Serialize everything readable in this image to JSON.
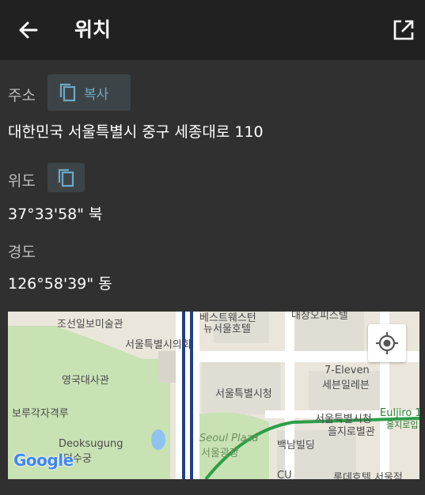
{
  "app_bar": {
    "title": "위치",
    "back_icon": "arrow-back-icon",
    "open_icon": "open-in-new-icon"
  },
  "address": {
    "label": "주소",
    "copy_label": "복사",
    "value": "대한민국 서울특별시 중구 세종대로 110"
  },
  "latitude": {
    "label": "위도",
    "value": "37°33'58\" 북"
  },
  "longitude": {
    "label": "경도",
    "value": "126°58'39\" 동"
  },
  "map": {
    "places": [
      "조선일보미술관",
      "서울특별시의회",
      "베스트웨스턴",
      "뉴서울호텔",
      "대창오피스텔",
      "영국대사관",
      "7-Eleven",
      "세븐일레븐",
      "서울특별시청",
      "보루각자격루",
      "서울특별시청",
      "을지로별관",
      "Euljiro 1",
      "을지로입",
      "Deoksugung",
      "덕수궁",
      "Seoul Plaza",
      "서울광장",
      "백남빌딩",
      "CU",
      "롯데호텔 서울점"
    ],
    "attribution": "Google",
    "locate_icon": "my-location-icon"
  },
  "colors": {
    "app_bar_bg": "#212121",
    "content_bg": "#303030",
    "accent": "#6fa8c7"
  }
}
